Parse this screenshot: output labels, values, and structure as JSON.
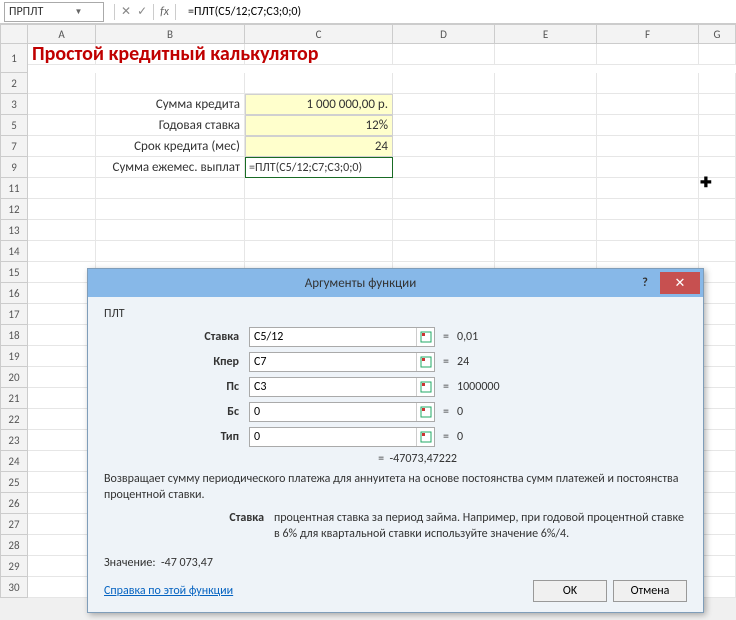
{
  "toolbar": {
    "namebox": "ПРПЛТ",
    "fx_cancel": "✕",
    "fx_ok": "✓",
    "fx_label": "fx",
    "formula": "=ПЛТ(C5/12;C7;C3;0;0)"
  },
  "columns": [
    "A",
    "B",
    "C",
    "D",
    "E",
    "F",
    "G"
  ],
  "row_numbers": [
    "1",
    "2",
    "3",
    "5",
    "7",
    "9",
    "11",
    "12",
    "13",
    "14",
    "15",
    "16",
    "17",
    "18",
    "19",
    "20",
    "21",
    "22",
    "23",
    "24",
    "25",
    "26",
    "27",
    "28",
    "29",
    "30"
  ],
  "sheet": {
    "title": "Простой кредитный калькулятор",
    "labels": {
      "sum": "Сумма кредита",
      "rate": "Годовая ставка",
      "term": "Срок кредита (мес)",
      "payment": "Сумма ежемес. выплат"
    },
    "values": {
      "sum": "1 000 000,00 р.",
      "rate": "12%",
      "term": "24",
      "formula_cell": "=ПЛТ(C5/12;C7;C3;0;0)"
    }
  },
  "dialog": {
    "title": "Аргументы функции",
    "help": "?",
    "close": "✕",
    "fn": "ПЛТ",
    "args": [
      {
        "label": "Ставка",
        "value": "C5/12",
        "result": "0,01"
      },
      {
        "label": "Кпер",
        "value": "C7",
        "result": "24"
      },
      {
        "label": "Пс",
        "value": "C3",
        "result": "1000000"
      },
      {
        "label": "Бс",
        "value": "0",
        "result": "0"
      },
      {
        "label": "Тип",
        "value": "0",
        "result": "0"
      }
    ],
    "eq": "=",
    "main_result": "-47073,47222",
    "description": "Возвращает сумму периодического платежа для аннуитета на основе постоянства сумм платежей и постоянства процентной ставки.",
    "param_name": "Ставка",
    "param_text": "процентная ставка за период займа. Например, при годовой процентной ставке в 6% для квартальной ставки используйте значение 6%/4.",
    "value_label": "Значение:",
    "value_result": "-47 073,47",
    "help_link": "Справка по этой функции",
    "ok": "OK",
    "cancel": "Отмена"
  }
}
